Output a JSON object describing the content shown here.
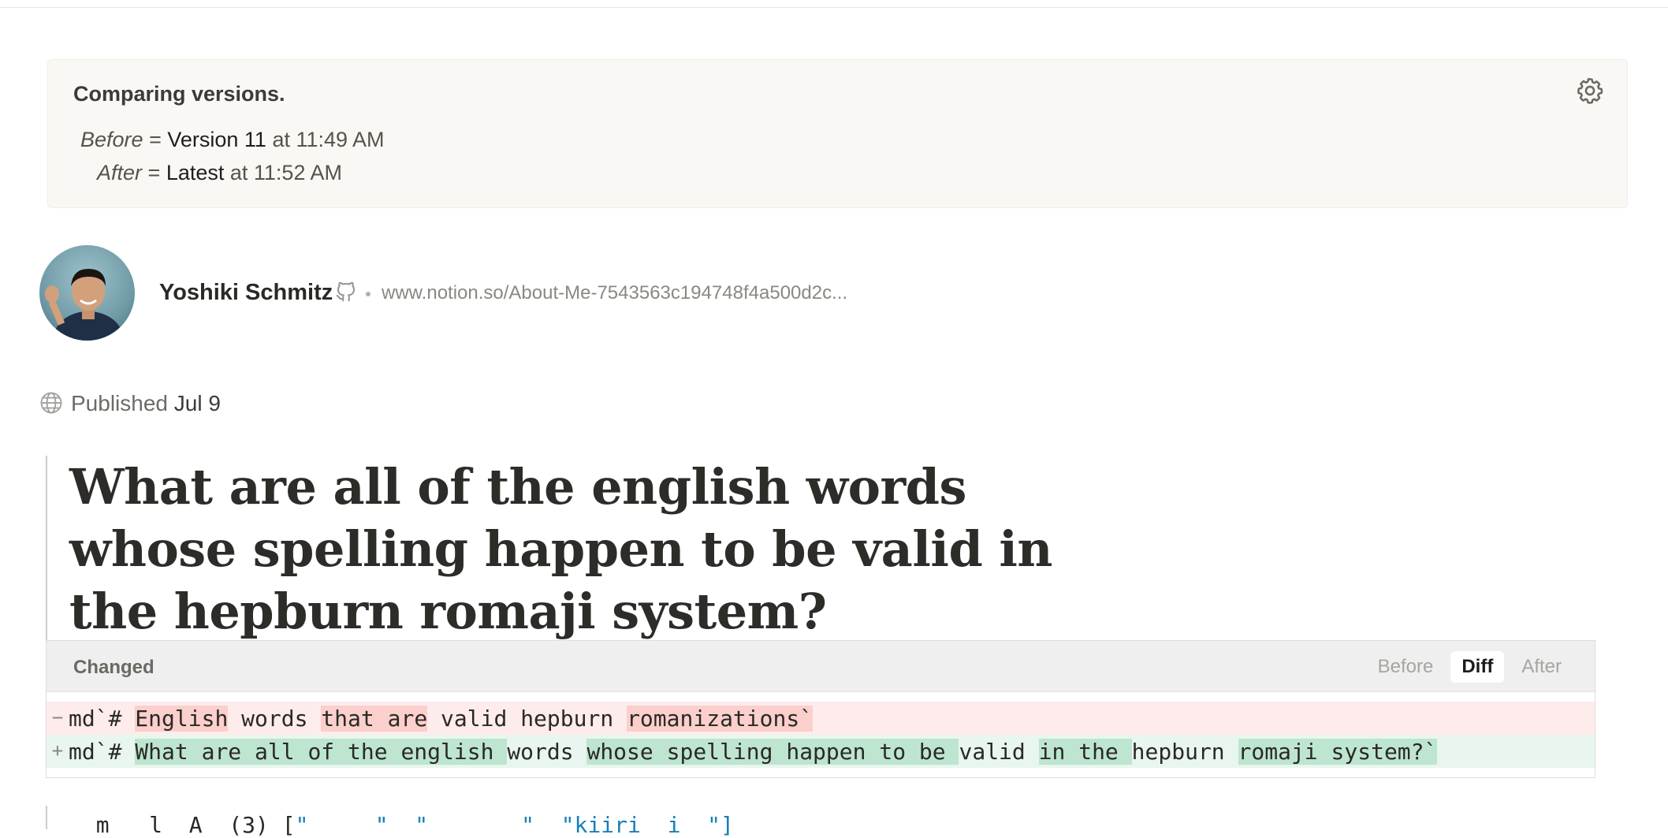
{
  "compare": {
    "title": "Comparing versions.",
    "before_role": "Before",
    "before_equals": " = ",
    "before_version": "Version 11",
    "before_time": " at 11:49 AM",
    "after_role": "After",
    "after_equals": " = ",
    "after_version": "Latest",
    "after_time": " at 11:52 AM",
    "settings_icon": "gear-icon"
  },
  "author": {
    "name": "Yoshiki Schmitz",
    "url": "www.notion.so/About-Me-7543563c194748f4a500d2c...",
    "icon": "github-icon"
  },
  "published": {
    "label": "Published",
    "date": "Jul 9",
    "icon": "globe-icon"
  },
  "page": {
    "title": "What are all of the english words whose spelling happen to be valid in the hepburn romaji system?"
  },
  "diff": {
    "header_label": "Changed",
    "tabs": [
      "Before",
      "Diff",
      "After"
    ],
    "active_tab": "Diff",
    "removed_sign": "−",
    "added_sign": "+",
    "removed_segments": [
      {
        "t": "md`# ",
        "k": "eq"
      },
      {
        "t": "English",
        "k": "del"
      },
      {
        "t": " words ",
        "k": "eq"
      },
      {
        "t": "that are",
        "k": "del"
      },
      {
        "t": " valid hepburn ",
        "k": "eq"
      },
      {
        "t": "romanizations`",
        "k": "del"
      }
    ],
    "added_segments": [
      {
        "t": "md`# ",
        "k": "eq"
      },
      {
        "t": "What are all of the english ",
        "k": "ins"
      },
      {
        "t": "words ",
        "k": "eq"
      },
      {
        "t": "whose spelling happen to be ",
        "k": "ins"
      },
      {
        "t": "valid ",
        "k": "eq"
      },
      {
        "t": "in the ",
        "k": "ins"
      },
      {
        "t": "hepburn ",
        "k": "eq"
      },
      {
        "t": "romaji system?`",
        "k": "ins"
      }
    ],
    "colors": {
      "removed_row": "#fdeceb",
      "removed_highlight": "#fbcfcc",
      "added_row": "#e8f6ef",
      "added_highlight": "#bde5d0"
    }
  },
  "next_block": {
    "prefix": "  m   l  A  (3) [",
    "strings": "\"     \"  \"       \"  \"kiiri  i  \"]"
  }
}
